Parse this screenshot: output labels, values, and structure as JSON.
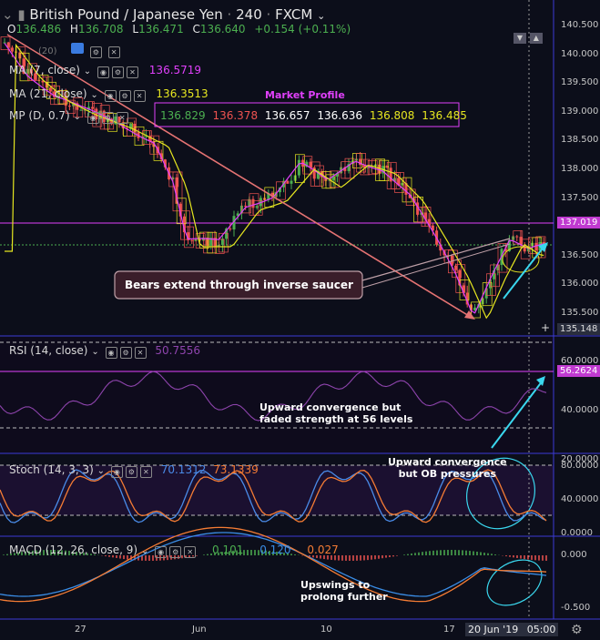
{
  "header": {
    "symbol": "British Pound / Japanese Yen",
    "interval": "240",
    "exchange": "FXCM",
    "ohlc": {
      "o_label": "O",
      "o": "136.486",
      "h_label": "H",
      "h": "136.708",
      "l_label": "L",
      "l": "136.471",
      "c_label": "C",
      "c": "136.640",
      "chg": "+0.154 (+0.11%)"
    },
    "small_hidden": "(20)"
  },
  "indicators": {
    "ma7": {
      "label": "MA (7, close)",
      "value": "136.5719",
      "color": "#e040fb"
    },
    "ma21": {
      "label": "MA (21, close)",
      "value": "136.3513",
      "color": "#e6e620"
    },
    "mp": {
      "label": "MP (D, 0.7)",
      "values": [
        "136.829",
        "136.378",
        "136.657",
        "136.636",
        "136.808",
        "136.485"
      ],
      "colors": [
        "#4caf50",
        "#ef5350",
        "#ffffff",
        "#ffffff",
        "#e6e620",
        "#e6e620"
      ]
    },
    "market_profile_title": "Market Profile",
    "rsi": {
      "label": "RSI (14, close)",
      "value": "50.7556"
    },
    "stoch": {
      "label": "Stoch (14, 3, 3)",
      "k": "70.1312",
      "d": "73.1339"
    },
    "macd": {
      "label": "MACD (12, 26, close, 9)",
      "v1": "0.101",
      "v2": "0.120",
      "v3": "0.027"
    }
  },
  "price_axis": [
    "140.500",
    "140.000",
    "139.500",
    "139.000",
    "138.500",
    "138.000",
    "137.500",
    "137.000",
    "136.500",
    "136.000",
    "135.500"
  ],
  "price_tags": {
    "hline": "137.019",
    "bottom": "135.148"
  },
  "rsi_axis": [
    "60.0000",
    "40.0000",
    "20.0000"
  ],
  "rsi_tag": "56.2624",
  "stoch_axis": [
    "80.0000",
    "40.0000",
    "0.0000"
  ],
  "macd_axis": [
    "0.000",
    "-0.500"
  ],
  "time_axis": [
    "27",
    "Jun",
    "10",
    "17"
  ],
  "time_cursor": "20 Jun '19",
  "time_hour": "05:00",
  "annotations": {
    "bears": "Bears extend through inverse saucer",
    "rsi_note": [
      "Upward convergence but",
      "faded strength at 56 levels"
    ],
    "stoch_note": [
      "Upward convergence",
      "but OB pressures"
    ],
    "macd_note": [
      "Upswings to",
      "prolong further"
    ]
  },
  "colors": {
    "bg": "#0c0e1a",
    "up": "#4caf50",
    "down": "#ef5350",
    "ma7": "#e040fb",
    "ma21": "#e6e620",
    "pane_border": "#3b3bd6",
    "cyan": "#3ad7ee"
  }
}
